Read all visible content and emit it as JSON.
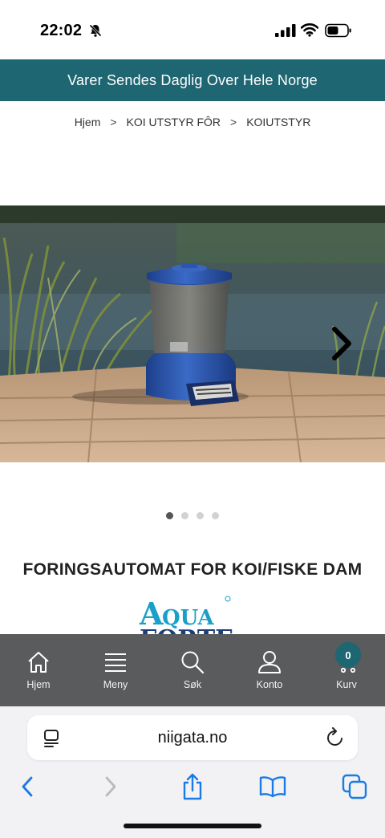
{
  "status": {
    "time": "22:02"
  },
  "banner": {
    "text": "Varer Sendes Daglig Over Hele Norge"
  },
  "breadcrumb": {
    "items": [
      "Hjem",
      "KOI UTSTYR FÔR",
      "KOIUTSTYR"
    ],
    "separator": ">"
  },
  "carousel": {
    "slide_count": 4,
    "active_index": 0
  },
  "product": {
    "title": "FORINGSAUTOMAT FOR KOI/FISKE DAM",
    "brand_logo_text": "AQUA FORTE"
  },
  "store_nav": {
    "items": [
      {
        "label": "Hjem",
        "icon": "home-icon"
      },
      {
        "label": "Meny",
        "icon": "menu-icon"
      },
      {
        "label": "Søk",
        "icon": "search-icon"
      },
      {
        "label": "Konto",
        "icon": "account-icon"
      },
      {
        "label": "Kurv",
        "icon": "cart-icon"
      }
    ],
    "cart_count": "0"
  },
  "browser": {
    "url": "niigata.no"
  },
  "colors": {
    "accent": "#1e6672",
    "nav_bg": "#595b5c",
    "link_blue": "#1a7ae6"
  }
}
